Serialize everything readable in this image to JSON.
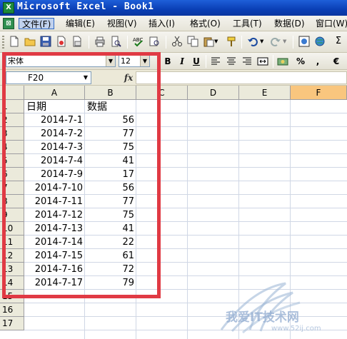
{
  "window": {
    "title": "Microsoft Excel - Book1",
    "app_icon_glyph": "X",
    "doc_icon_glyph": "⊠"
  },
  "menu": {
    "items": [
      {
        "label": "文件(F)",
        "active": true
      },
      {
        "label": "编辑(E)"
      },
      {
        "label": "视图(V)"
      },
      {
        "label": "插入(I)"
      },
      {
        "label": "格式(O)"
      },
      {
        "label": "工具(T)"
      },
      {
        "label": "数据(D)"
      },
      {
        "label": "窗口(W)"
      }
    ]
  },
  "format_toolbar": {
    "font_name": "宋体",
    "font_size": "12",
    "bold": "B",
    "italic": "I",
    "underline": "U",
    "percent": "%",
    "comma": ",",
    "euro": "€",
    "sigma": "Σ"
  },
  "formula_bar": {
    "name_box": "F20",
    "fx": "fx",
    "formula": ""
  },
  "columns": [
    "A",
    "B",
    "C",
    "D",
    "E",
    "F"
  ],
  "selected_column": "F",
  "rows": [
    "1",
    "2",
    "3",
    "4",
    "5",
    "6",
    "7",
    "8",
    "9",
    "10",
    "11",
    "12",
    "13",
    "14",
    "15",
    "16",
    "17"
  ],
  "table": {
    "headers": [
      "日期",
      "数据"
    ],
    "records": [
      {
        "date": "2014-7-1",
        "value": "56"
      },
      {
        "date": "2014-7-2",
        "value": "77"
      },
      {
        "date": "2014-7-3",
        "value": "75"
      },
      {
        "date": "2014-7-4",
        "value": "41"
      },
      {
        "date": "2014-7-9",
        "value": "17"
      },
      {
        "date": "2014-7-10",
        "value": "56"
      },
      {
        "date": "2014-7-11",
        "value": "77"
      },
      {
        "date": "2014-7-12",
        "value": "75"
      },
      {
        "date": "2014-7-13",
        "value": "41"
      },
      {
        "date": "2014-7-14",
        "value": "22"
      },
      {
        "date": "2014-7-15",
        "value": "61"
      },
      {
        "date": "2014-7-16",
        "value": "72"
      },
      {
        "date": "2014-7-17",
        "value": "79"
      }
    ]
  },
  "watermark": {
    "text": "我爱IT技术网",
    "url": "www.52ij.com"
  },
  "colors": {
    "highlight_box": "#e03a44",
    "selected_column_header": "#f9c67e",
    "title_bar": "#0a3fb5"
  }
}
